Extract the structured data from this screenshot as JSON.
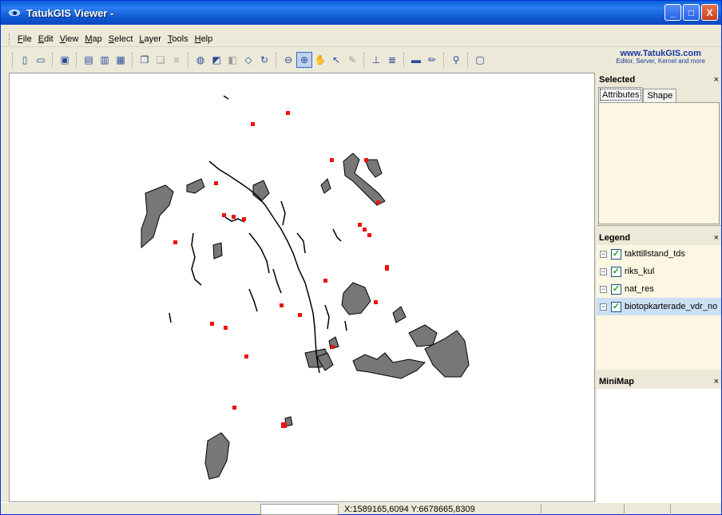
{
  "window": {
    "title": "TatukGIS Viewer -",
    "minimize": "_",
    "maximize": "□",
    "close": "X"
  },
  "menu": [
    "File",
    "Edit",
    "View",
    "Map",
    "Select",
    "Layer",
    "Tools",
    "Help"
  ],
  "toolbar": {
    "buttons": [
      {
        "icon": "new-icon",
        "glyph": "▯"
      },
      {
        "icon": "open-icon",
        "glyph": "▭"
      },
      {
        "icon": "save-icon",
        "glyph": "▣"
      },
      {
        "icon": "print-icon",
        "glyph": "▤"
      },
      {
        "icon": "print-preview-icon",
        "glyph": "▥"
      },
      {
        "icon": "export-icon",
        "glyph": "▦"
      },
      {
        "icon": "copy-icon",
        "glyph": "❐"
      },
      {
        "icon": "paste-icon",
        "glyph": "❏"
      },
      {
        "icon": "layer-props-icon",
        "glyph": "≡"
      },
      {
        "icon": "add-layer-icon",
        "glyph": "◍"
      },
      {
        "icon": "full-extent-icon",
        "glyph": "◩"
      },
      {
        "icon": "zoom-previous-icon",
        "glyph": "◧"
      },
      {
        "icon": "pan-back-icon",
        "glyph": "◇"
      },
      {
        "icon": "refresh-icon",
        "glyph": "↻"
      },
      {
        "icon": "zoom-out-icon",
        "glyph": "⊖"
      },
      {
        "icon": "zoom-in-icon",
        "glyph": "⊕"
      },
      {
        "icon": "pan-hand-icon",
        "glyph": "✋"
      },
      {
        "icon": "select-arrow-icon",
        "glyph": "↖"
      },
      {
        "icon": "edit-vertex-icon",
        "glyph": "✎"
      },
      {
        "icon": "measure-line-icon",
        "glyph": "⊥"
      },
      {
        "icon": "measure-area-icon",
        "glyph": "≣"
      },
      {
        "icon": "ruler-icon",
        "glyph": "▬"
      },
      {
        "icon": "style-icon",
        "glyph": "✏"
      },
      {
        "icon": "find-icon",
        "glyph": "⚲"
      },
      {
        "icon": "info-icon",
        "glyph": "▢"
      }
    ],
    "promo_url": "www.TatukGIS.com",
    "promo_sub": "Editor, Server, Kernel and more"
  },
  "selected_panel": {
    "title": "Selected",
    "close": "×",
    "tabs": [
      "Attributes",
      "Shape"
    ],
    "active_tab": "Attributes"
  },
  "legend_panel": {
    "title": "Legend",
    "close": "×",
    "layers": [
      {
        "name": "takttillstand_tds",
        "checked": true,
        "selected": false
      },
      {
        "name": "riks_kul",
        "checked": true,
        "selected": false
      },
      {
        "name": "nat_res",
        "checked": true,
        "selected": false
      },
      {
        "name": "biotopkarterade_vdr_no",
        "checked": true,
        "selected": true
      }
    ]
  },
  "minimap_panel": {
    "title": "MiniMap",
    "close": "×"
  },
  "status": {
    "coords": "X:1589165,6094  Y:6678665,8309"
  },
  "colors": {
    "polygon_fill": "#777777",
    "point_marker": "#ee1111",
    "line_color": "#000000"
  }
}
